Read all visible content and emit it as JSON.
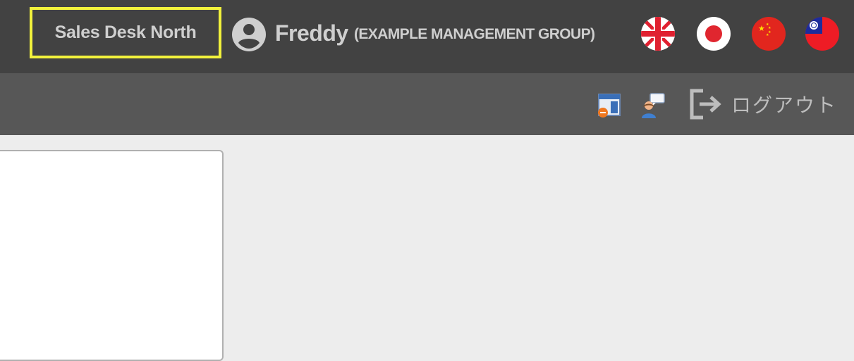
{
  "header": {
    "desk_label": "Sales Desk North",
    "user_icon": "account-circle-icon",
    "user_name": "Freddy",
    "organization": "(EXAMPLE MANAGEMENT GROUP)",
    "highlight_color": "#f2f23c",
    "languages": [
      {
        "name": "english",
        "icon": "uk-flag-icon"
      },
      {
        "name": "japanese",
        "icon": "japan-flag-icon"
      },
      {
        "name": "chinese",
        "icon": "china-flag-icon"
      },
      {
        "name": "taiwanese",
        "icon": "taiwan-flag-icon"
      }
    ]
  },
  "toolbar": {
    "icons": [
      "window-minus-icon",
      "user-chat-icon"
    ],
    "logout_icon": "logout-arrow-icon",
    "logout_label": "ログアウト"
  },
  "colors": {
    "header_bg": "#424242",
    "toolbar_bg": "#575757",
    "page_bg": "#ededed",
    "header_text": "#cfcfcf"
  }
}
